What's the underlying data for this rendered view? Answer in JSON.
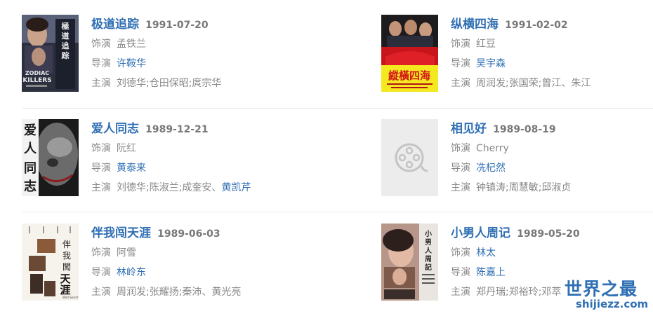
{
  "labels": {
    "role": "饰演",
    "director": "导演",
    "cast": "主演"
  },
  "movies": [
    {
      "title": "极道追踪",
      "date": "1991-07-20",
      "role": "孟铁兰",
      "director": "许鞍华",
      "cast_plain": "刘德华;仓田保昭;庹宗华",
      "cast_links": [],
      "poster": "poster-zodiac-killers",
      "poster_text": "極道追踪",
      "poster_sub": "ZODIAC KILLERS"
    },
    {
      "title": "纵横四海",
      "date": "1991-02-02",
      "role": "红豆",
      "director": "吴宇森",
      "cast_plain": "周润发;张国荣;曾江、朱江",
      "cast_links": [],
      "poster": "poster-once-a-thief",
      "poster_text": "縱橫四海"
    },
    {
      "title": "爱人同志",
      "date": "1989-12-21",
      "role": "阮红",
      "director": "黄泰来",
      "cast_plain": "刘德华;陈淑兰;成奎安、",
      "cast_links": [
        "黄凯芹"
      ],
      "poster": "poster-face-closeup",
      "poster_text": "爱人同志"
    },
    {
      "title": "相见好",
      "date": "1989-08-19",
      "role": "Cherry",
      "director": "冼杞然",
      "cast_plain": "钟镇涛;周慧敏;邱淑贞",
      "cast_links": [],
      "poster": "film-reel-placeholder-icon"
    },
    {
      "title": "伴我闯天涯",
      "date": "1989-06-03",
      "role": "阿雪",
      "director": "林岭东",
      "cast_plain": "周润发;张耀扬;秦沛、黄光亮",
      "cast_links": [],
      "poster": "poster-wild-search",
      "poster_text": "伴我闖天涯",
      "poster_sub": "Wild Search"
    },
    {
      "title": "小男人周记",
      "date": "1989-05-20",
      "role": "林太",
      "director": "陈嘉上",
      "cast_plain": "郑丹瑞;郑裕玲;邓萃",
      "cast_links": [],
      "poster": "poster-yuppie-fantasia",
      "poster_text": "小男人周記"
    }
  ],
  "watermark": {
    "cn": "世界之最",
    "en": "shijiezz.com",
    "color": "#2f6fb3"
  },
  "colors": {
    "link": "#2f6fb3",
    "text": "#888888",
    "divider": "#e8e8e8"
  }
}
